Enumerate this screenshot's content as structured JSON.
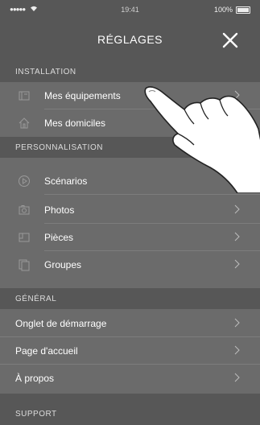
{
  "status": {
    "time": "19:41",
    "battery": "100%"
  },
  "header": {
    "title": "RÉGLAGES"
  },
  "sections": {
    "installation": "INSTALLATION",
    "personnalisation": "PERSONNALISATION",
    "general": "GÉNÉRAL",
    "support": "SUPPORT"
  },
  "installation_items": [
    {
      "label": "Mes équipements"
    },
    {
      "label": "Mes domiciles"
    }
  ],
  "personnalisation_items": [
    {
      "label": "Scénarios"
    },
    {
      "label": "Photos"
    },
    {
      "label": "Pièces"
    },
    {
      "label": "Groupes"
    }
  ],
  "general_items": [
    {
      "label": "Onglet de démarrage"
    },
    {
      "label": "Page d'accueil"
    },
    {
      "label": "À propos"
    }
  ]
}
